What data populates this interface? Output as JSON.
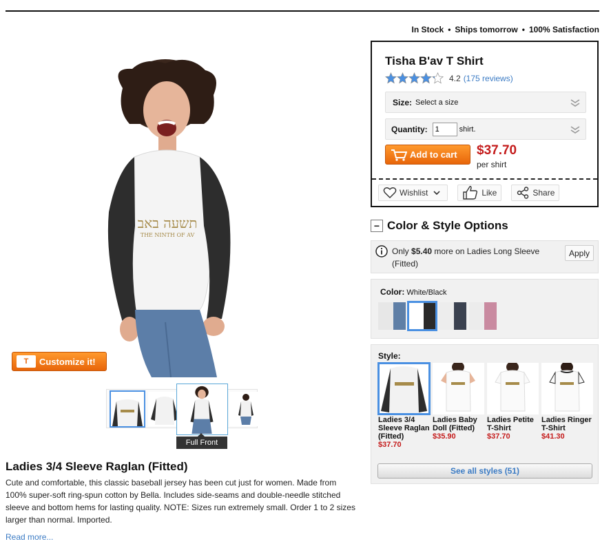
{
  "availability": {
    "in_stock": "In Stock",
    "ships": "Ships tomorrow",
    "satisfaction": "100% Satisfaction"
  },
  "product": {
    "name": "Tisha B'av T Shirt",
    "rating": 4.2,
    "rating_text": "4.2",
    "reviews_link": "(175 reviews)",
    "size_label": "Size:",
    "size_value": "Select a size",
    "quantity_label": "Quantity:",
    "quantity_value": "1",
    "quantity_unit": "shirt.",
    "add_to_cart": "Add to cart",
    "price": "$37.70",
    "per": "per shirt",
    "wishlist": "Wishlist",
    "like": "Like",
    "share": "Share"
  },
  "hero": {
    "shirt_text_main": "תשעה באב",
    "shirt_text_sub": "THE NINTH OF AV",
    "customize": "Customize it!",
    "customize_icon": "T",
    "active_view": "Full Front"
  },
  "color_style": {
    "title": "Color & Style Options",
    "toggle": "−",
    "upsell_prefix": "Only",
    "upsell_amount": "$5.40",
    "upsell_rest": "more on Ladies Long Sleeve (Fitted)",
    "apply": "Apply",
    "color_label": "Color:",
    "color_value": "White/Black",
    "swatches": [
      {
        "main": "#e7e7e7",
        "accent": "#5f7fa6"
      },
      {
        "main": "#ffffff",
        "accent": "#2a2a2a"
      },
      {
        "main": "#ededed",
        "accent": "#3b4250"
      },
      {
        "main": "#ececec",
        "accent": "#c98aa0"
      }
    ],
    "style_label": "Style:",
    "styles": [
      {
        "name": "Ladies 3/4 Sleeve Raglan (Fitted)",
        "price": "$37.70"
      },
      {
        "name": "Ladies Baby Doll (Fitted)",
        "price": "$35.90"
      },
      {
        "name": "Ladies Petite T-Shirt",
        "price": "$37.70"
      },
      {
        "name": "Ladies Ringer T-Shirt",
        "price": "$41.30"
      }
    ],
    "see_all": "See all styles (51)"
  },
  "description": {
    "title": "Ladies 3/4 Sleeve Raglan (Fitted)",
    "body": "Cute and comfortable, this classic baseball jersey has been cut just for women. Made from 100% super-soft ring-spun cotton by Bella. Includes side-seams and double-needle stitched sleeve and bottom hems for lasting quality. NOTE: Sizes run extremely small. Order 1 to 2 sizes larger than normal. Imported.",
    "read_more": "Read more..."
  },
  "colors": {
    "accent_orange": "#e8650a",
    "price_red": "#c41b1b",
    "link_blue": "#3b7bc4",
    "selection_blue": "#4a90e2"
  }
}
